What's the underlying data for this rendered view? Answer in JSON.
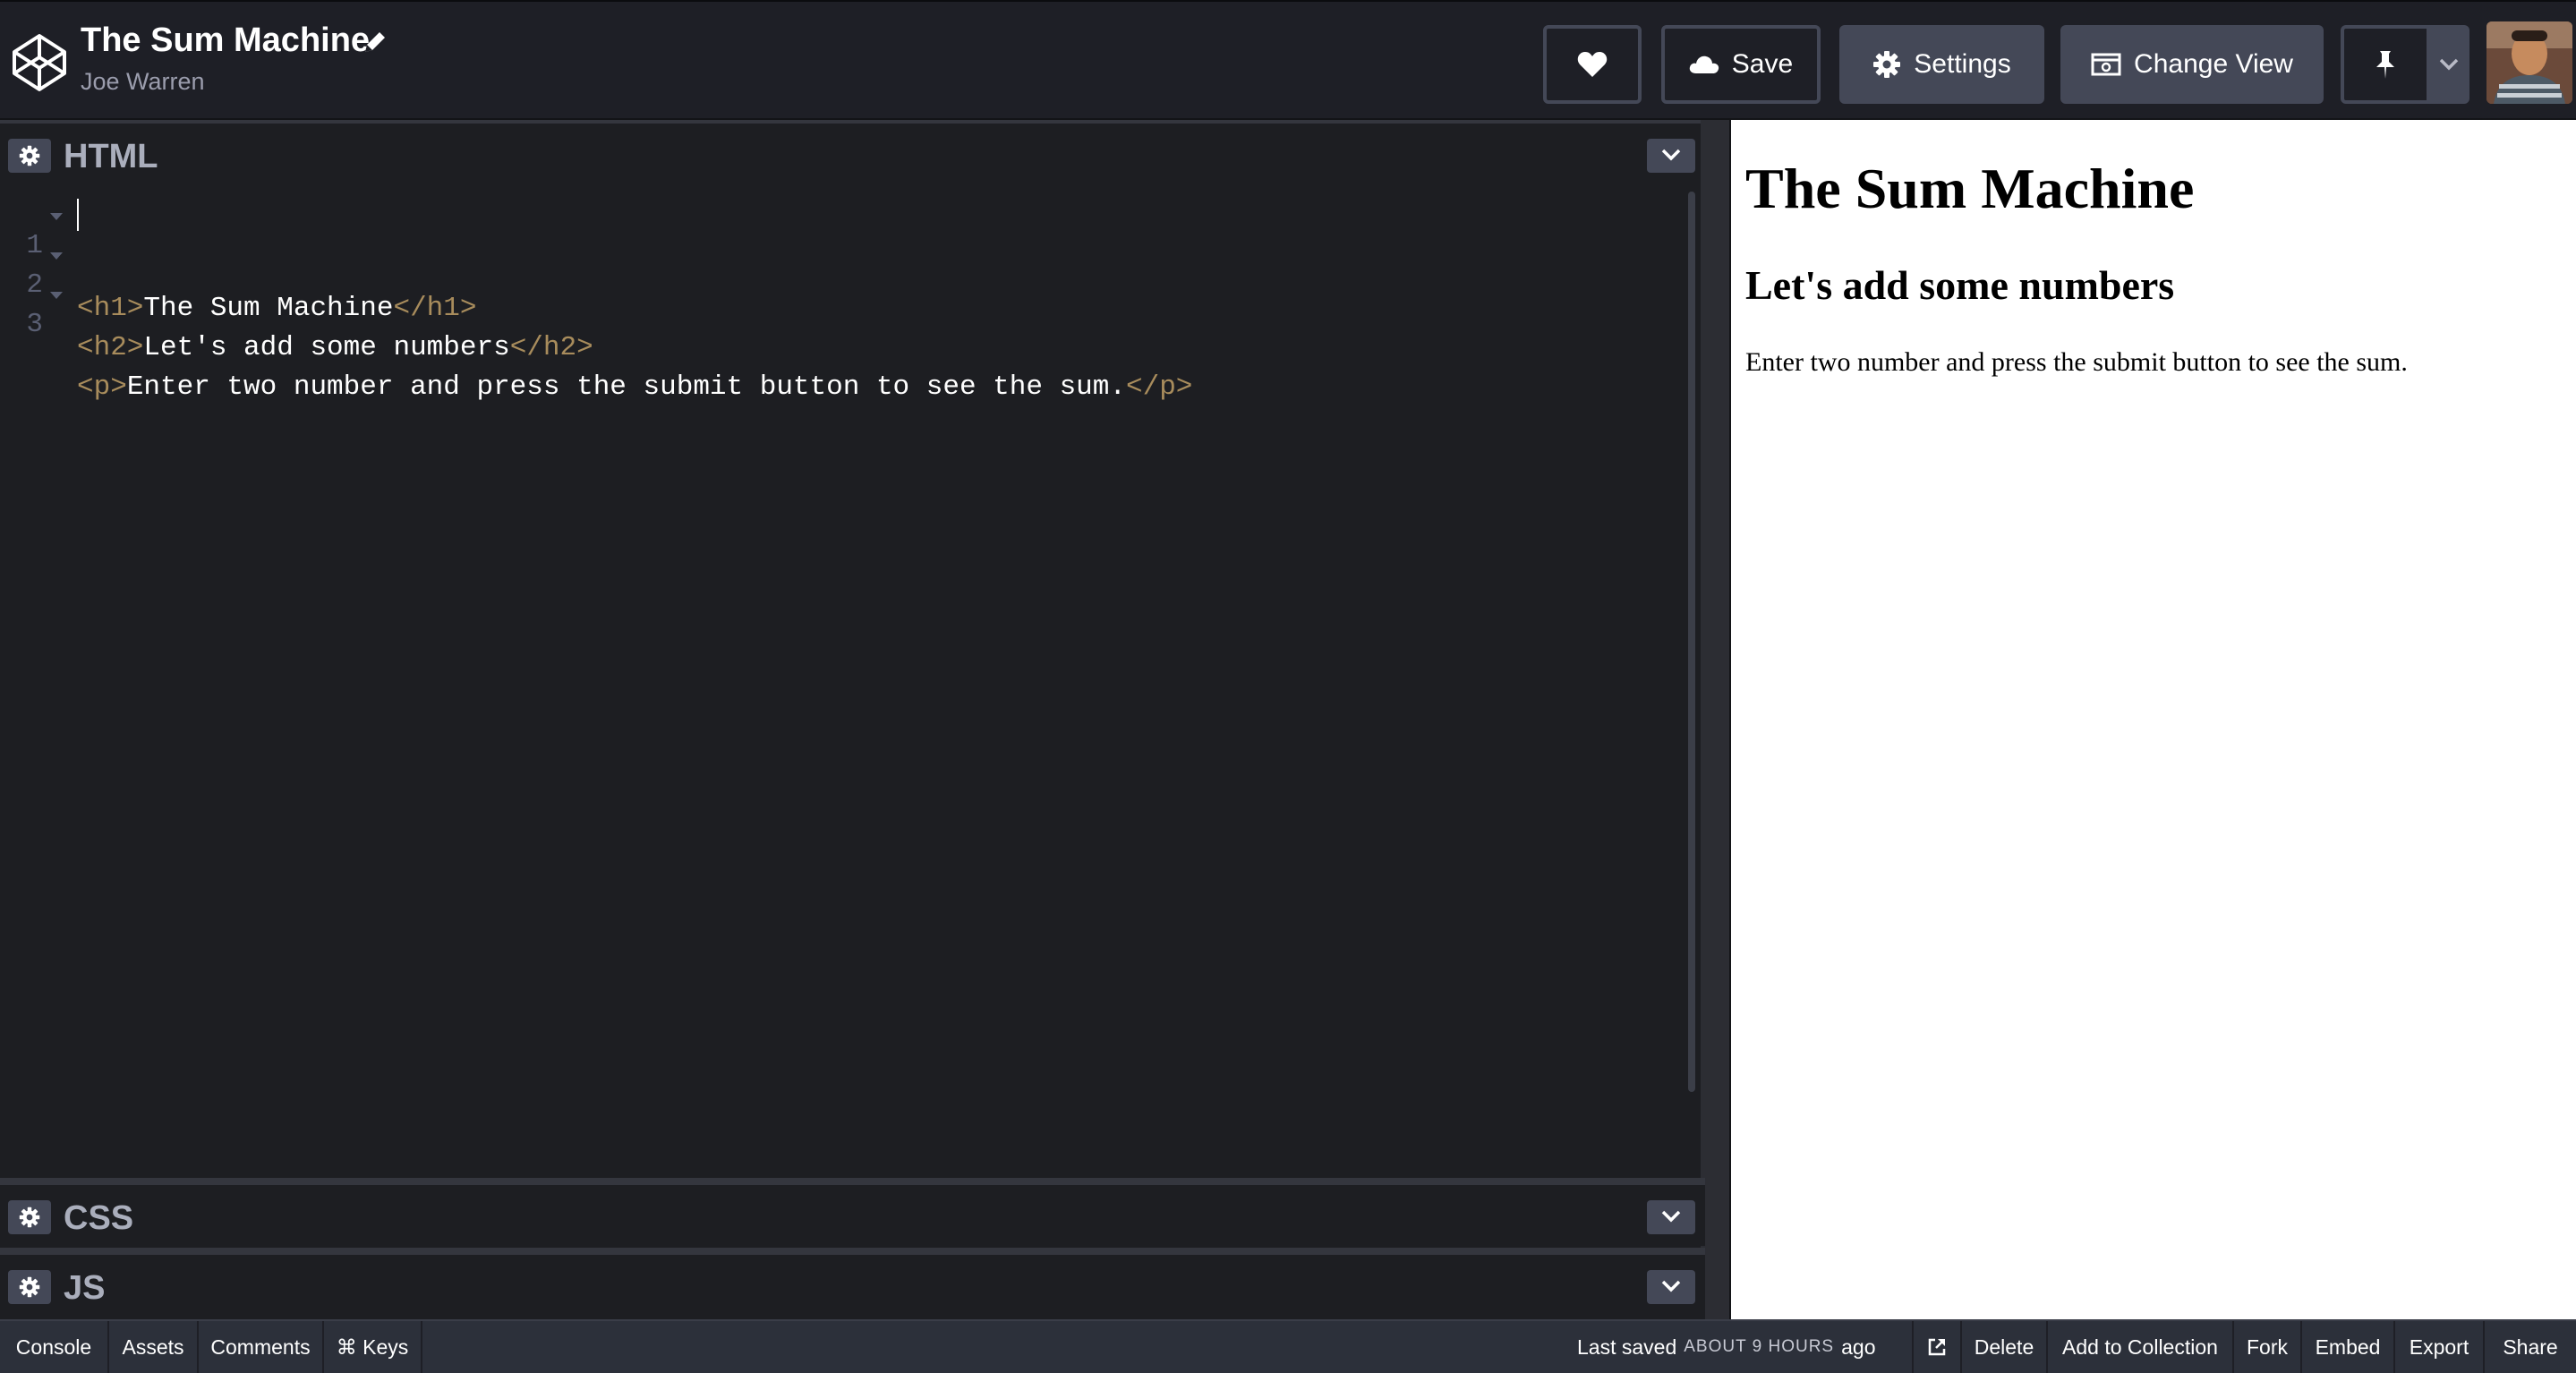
{
  "header": {
    "title": "The Sum Machine",
    "author": "Joe Warren",
    "save_label": "Save",
    "settings_label": "Settings",
    "change_view_label": "Change View",
    "icons": [
      "codepen-logo-icon",
      "pencil-icon",
      "heart-icon",
      "cloud-icon",
      "gear-icon",
      "change-view-icon",
      "pin-icon",
      "chevron-down-icon",
      "avatar"
    ]
  },
  "editors": {
    "html": {
      "title": "HTML",
      "lines": [
        {
          "num": "1",
          "open_tag": "<h1>",
          "text": "The Sum Machine",
          "close_tag": "</h1>"
        },
        {
          "num": "2",
          "open_tag": "<h2>",
          "text": "Let's add some numbers",
          "close_tag": "</h2>"
        },
        {
          "num": "3",
          "open_tag": "<p>",
          "text": "Enter two number and press the submit button to see the sum.",
          "close_tag": "</p>"
        }
      ]
    },
    "css": {
      "title": "CSS"
    },
    "js": {
      "title": "JS"
    }
  },
  "preview": {
    "h1": "The Sum Machine",
    "h2": "Let's add some numbers",
    "p": "Enter two number and press the submit button to see the sum."
  },
  "footer": {
    "console": "Console",
    "assets": "Assets",
    "comments": "Comments",
    "keys": "⌘ Keys",
    "last_saved_prefix": "Last saved",
    "last_saved_time": "ABOUT 9 HOURS",
    "last_saved_suffix": "ago",
    "delete": "Delete",
    "add_to_collection": "Add to Collection",
    "fork": "Fork",
    "embed": "Embed",
    "export": "Export",
    "share": "Share"
  },
  "colors": {
    "header_bg": "#1e1f26",
    "editor_bg": "#1d1e22",
    "button_gray": "#444857",
    "tag_color": "#a88c5c",
    "footer_bg": "#2c303a",
    "preview_bg": "#ffffff"
  }
}
